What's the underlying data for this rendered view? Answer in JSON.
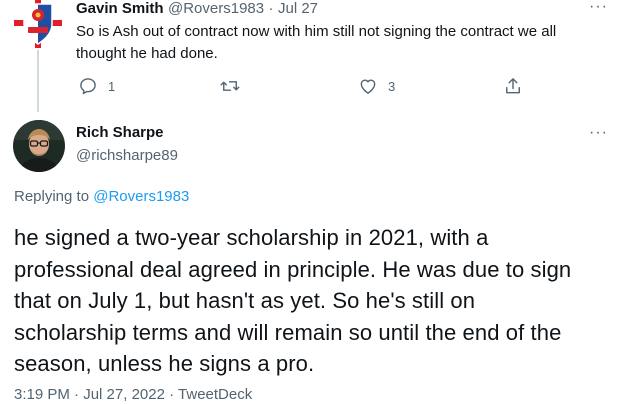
{
  "reply_tweet": {
    "name": "Gavin Smith",
    "handle": "@Rovers1983",
    "separator": "·",
    "date": "Jul 27",
    "text": "So is Ash out of contract now with him still not signing the contract we all thought he had done.",
    "actions": {
      "reply_count": "1",
      "retweet_count": "",
      "like_count": "3"
    },
    "more_label": "···"
  },
  "main_tweet": {
    "name": "Rich Sharpe",
    "handle": "@richsharpe89",
    "more_label": "···",
    "replying_prefix": "Replying to",
    "replying_to": "@Rovers1983",
    "text": "he signed a two-year scholarship in 2021, with a professional deal agreed in principle. He was due to sign that on July 1, but hasn't as yet. So he's still on scholarship terms and will remain so until the end of the season, unless he signs a pro.",
    "time": "3:19 PM",
    "date": "Jul 27, 2022",
    "source": "TweetDeck",
    "meta_separator": "·"
  },
  "colors": {
    "link": "#1d9bf0",
    "muted": "#536471",
    "text": "#0f1419"
  }
}
